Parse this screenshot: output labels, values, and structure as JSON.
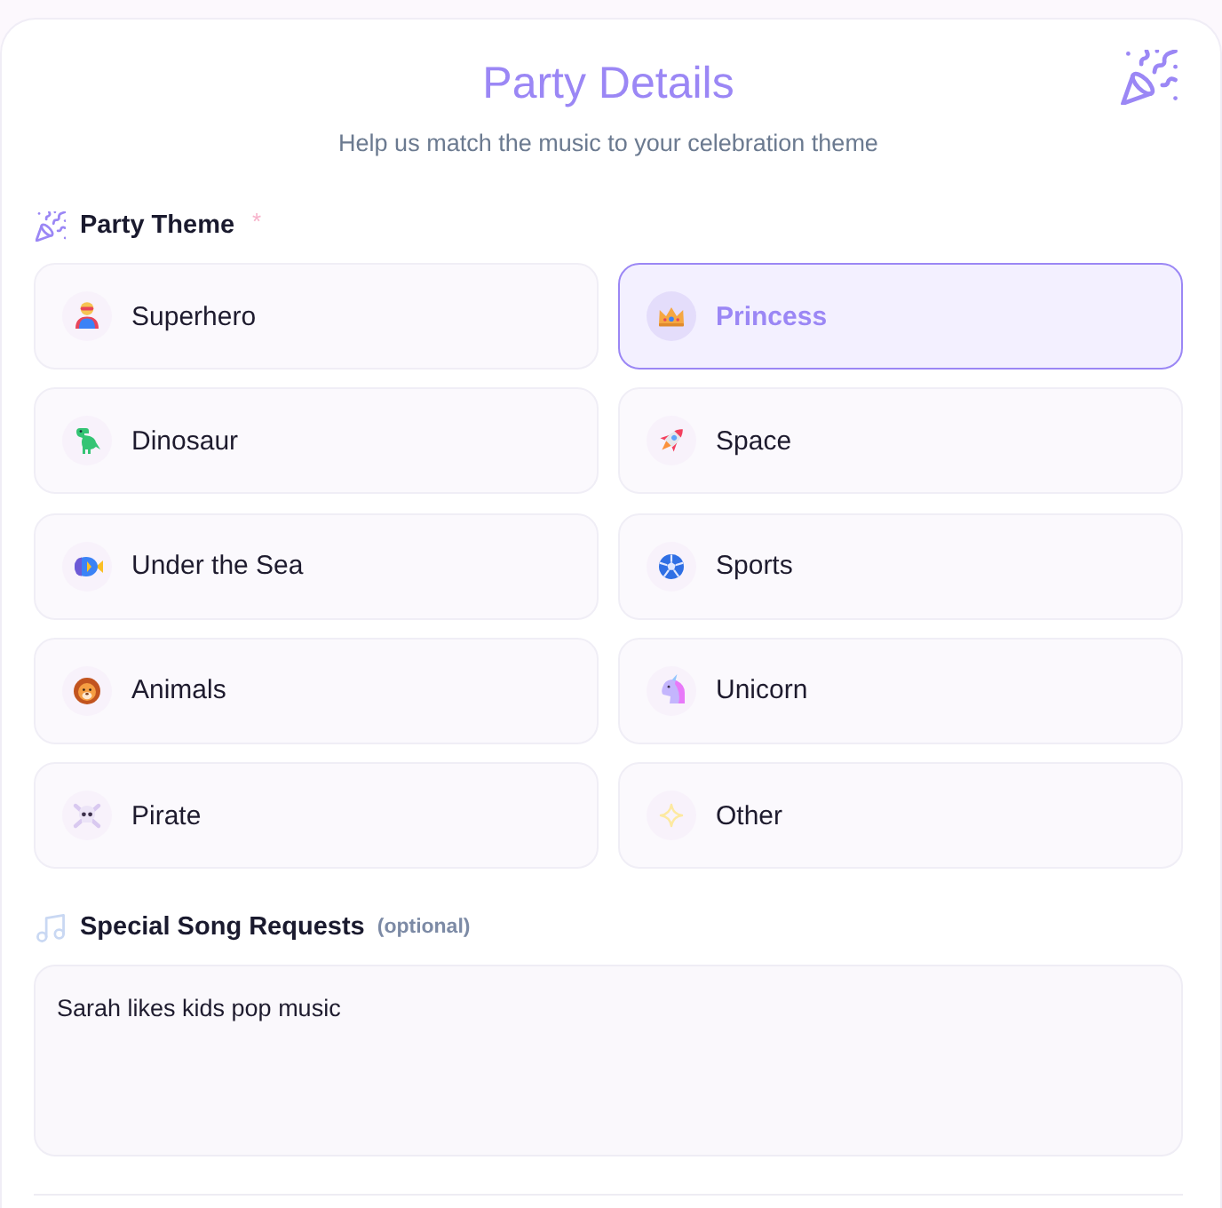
{
  "header": {
    "title": "Party Details",
    "subtitle": "Help us match the music to your celebration theme"
  },
  "theme_field": {
    "label": "Party Theme",
    "required_mark": "*",
    "options": [
      {
        "label": "Superhero",
        "selected": false
      },
      {
        "label": "Princess",
        "selected": true
      },
      {
        "label": "Dinosaur",
        "selected": false
      },
      {
        "label": "Space",
        "selected": false
      },
      {
        "label": "Under the Sea",
        "selected": false
      },
      {
        "label": "Sports",
        "selected": false
      },
      {
        "label": "Animals",
        "selected": false
      },
      {
        "label": "Unicorn",
        "selected": false
      },
      {
        "label": "Pirate",
        "selected": false
      },
      {
        "label": "Other",
        "selected": false
      }
    ]
  },
  "song_field": {
    "label": "Special Song Requests",
    "hint": "(optional)",
    "value": "Sarah likes kids pop music"
  }
}
